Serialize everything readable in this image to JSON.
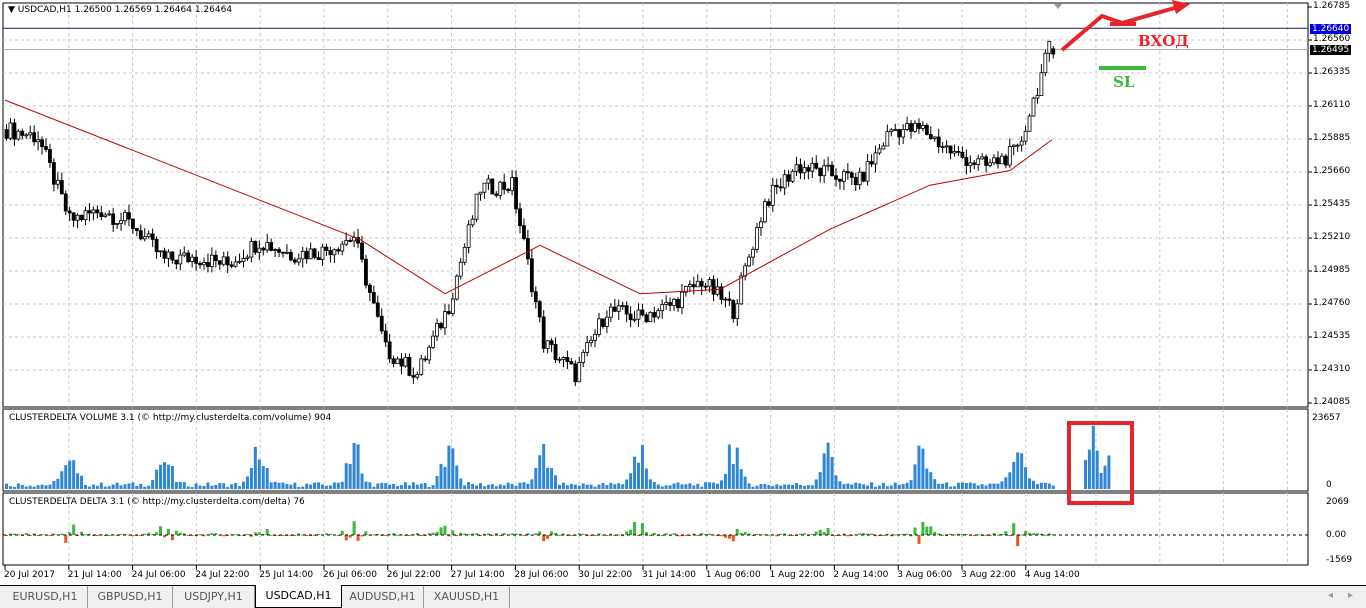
{
  "header": {
    "symbol_info": "USDCAD,H1  1.26500 1.26569 1.26464 1.26464"
  },
  "price_axis": {
    "ticks": [
      "1.26785",
      "1.26560",
      "1.26335",
      "1.26110",
      "1.25885",
      "1.25660",
      "1.25435",
      "1.25210",
      "1.24985",
      "1.24760",
      "1.24535",
      "1.24310",
      "1.24085"
    ],
    "ask_label": "1.26640",
    "bid_label": "1.26495",
    "ask_color": "#0000e0",
    "bid_color": "#000000"
  },
  "time_axis": {
    "ticks": [
      "20 Jul 2017",
      "21 Jul 14:00",
      "24 Jul 06:00",
      "24 Jul 22:00",
      "25 Jul 14:00",
      "26 Jul 06:00",
      "26 Jul 22:00",
      "27 Jul 14:00",
      "28 Jul 06:00",
      "30 Jul 22:00",
      "31 Jul 14:00",
      "1 Aug 06:00",
      "1 Aug 22:00",
      "2 Aug 14:00",
      "3 Aug 06:00",
      "3 Aug 22:00",
      "4 Aug 14:00"
    ]
  },
  "chart_data": [
    {
      "type": "candlestick",
      "title": "USDCAD,H1",
      "ylim": [
        1.24085,
        1.26785
      ],
      "grid": true,
      "close_path_every_8_bars": [
        1.2595,
        1.259,
        1.2533,
        1.254,
        1.253,
        1.2506,
        1.2508,
        1.2503,
        1.2519,
        1.251,
        1.2512,
        1.2522,
        1.2445,
        1.2428,
        1.2475,
        1.2555,
        1.2557,
        1.245,
        1.2428,
        1.2472,
        1.2467,
        1.2475,
        1.2492,
        1.2472,
        1.2545,
        1.257,
        1.2565,
        1.256,
        1.2595,
        1.2595,
        1.2578,
        1.257,
        1.258,
        1.265
      ],
      "last": {
        "open": 1.265,
        "high": 1.26569,
        "low": 1.26464,
        "close": 1.26464
      },
      "moving_average_path": [
        1.2615,
        1.252,
        1.2483,
        1.2516,
        1.2483,
        1.2486,
        1.2527,
        1.2557,
        1.2567,
        1.2588
      ],
      "ma_color": "#c00000"
    },
    {
      "type": "bar",
      "title": "CLUSTERDELTA VOLUME 3.1 (© http://my.clusterdelta.com/volume) 904",
      "ylim": [
        0,
        23657
      ],
      "color": "#2e86d6",
      "highlighted_volumes": [
        8937,
        12091,
        19451,
        11776,
        4942,
        7150,
        10304
      ]
    },
    {
      "type": "bar",
      "title": "CLUSTERDELTA DELTA 3.1 (© http://my.clusterdelta.com/delta) 76",
      "ylim": [
        -1569,
        2069
      ],
      "ticks": [
        "2069",
        "0.00",
        "-1569"
      ],
      "positive_color": "#3cb83c",
      "negative_color": "#e05a1a"
    }
  ],
  "annotations": {
    "entry_label": "ВХОД",
    "stop_label": "SL",
    "entry_color": "#e8232a",
    "stop_color": "#3cb83c"
  },
  "volume_axis": {
    "max": "23657",
    "min": "0"
  },
  "tabs": [
    "EURUSD,H1",
    "GBPUSD,H1",
    "USDJPY,H1",
    "USDCAD,H1",
    "AUDUSD,H1",
    "XAUUSD,H1"
  ],
  "active_tab": "USDCAD,H1"
}
